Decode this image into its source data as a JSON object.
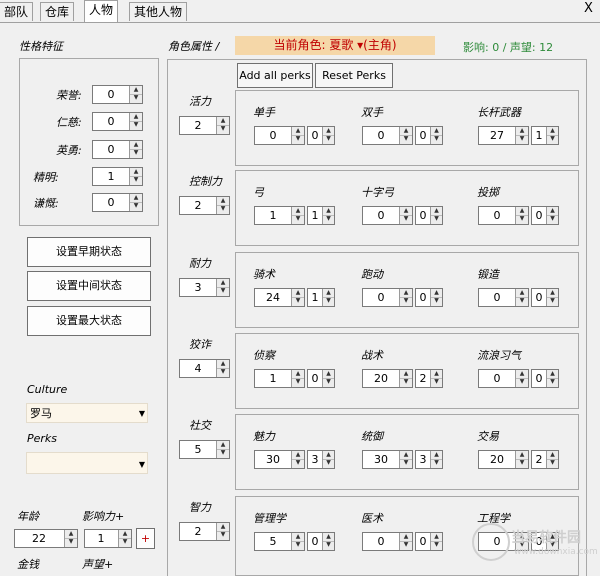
{
  "tabs": [
    "部队",
    "仓库",
    "人物",
    "其他人物"
  ],
  "close_label": "X",
  "personality": {
    "title": "性格特征",
    "traits": [
      {
        "label": "荣誉:",
        "value": "0"
      },
      {
        "label": "仁慈:",
        "value": "0"
      },
      {
        "label": "英勇:",
        "value": "0"
      },
      {
        "label": "精明:",
        "value": "1"
      },
      {
        "label": "谦慨:",
        "value": "0"
      }
    ]
  },
  "state_buttons": [
    "设置早期状态",
    "设置中间状态",
    "设置最大状态"
  ],
  "culture": {
    "label": "Culture",
    "value": "罗马"
  },
  "perks": {
    "label": "Perks",
    "value": ""
  },
  "age": {
    "label": "年龄",
    "value": "22"
  },
  "influence_plus": {
    "label": "影响力+",
    "value": "1",
    "button": "+"
  },
  "gold": {
    "label": "金钱"
  },
  "renown_plus": {
    "label": "声望+"
  },
  "attributes_title": "角色属性",
  "attributes_title_suffix": "/",
  "current_role": "当前角色: 夏歌 ▾(主角)",
  "influence_renown": "影响: 0 / 声望: 12",
  "add_all_perks": "Add all perks",
  "reset_perks": "Reset Perks",
  "attributes": [
    {
      "name": "活力",
      "value": "2",
      "skills": [
        {
          "name": "单手",
          "value": "0",
          "focus": "0"
        },
        {
          "name": "双手",
          "value": "0",
          "focus": "0"
        },
        {
          "name": "长杆武器",
          "value": "27",
          "focus": "1"
        }
      ]
    },
    {
      "name": "控制力",
      "value": "2",
      "skills": [
        {
          "name": "弓",
          "value": "1",
          "focus": "1"
        },
        {
          "name": "十字弓",
          "value": "0",
          "focus": "0"
        },
        {
          "name": "投掷",
          "value": "0",
          "focus": "0"
        }
      ]
    },
    {
      "name": "耐力",
      "value": "3",
      "skills": [
        {
          "name": "骑术",
          "value": "24",
          "focus": "1"
        },
        {
          "name": "跑动",
          "value": "0",
          "focus": "0"
        },
        {
          "name": "锻造",
          "value": "0",
          "focus": "0"
        }
      ]
    },
    {
      "name": "狡诈",
      "value": "4",
      "skills": [
        {
          "name": "侦察",
          "value": "1",
          "focus": "0"
        },
        {
          "name": "战术",
          "value": "20",
          "focus": "2"
        },
        {
          "name": "流浪习气",
          "value": "0",
          "focus": "0"
        }
      ]
    },
    {
      "name": "社交",
      "value": "5",
      "skills": [
        {
          "name": "魅力",
          "value": "30",
          "focus": "3"
        },
        {
          "name": "统御",
          "value": "30",
          "focus": "3"
        },
        {
          "name": "交易",
          "value": "20",
          "focus": "2"
        }
      ]
    },
    {
      "name": "智力",
      "value": "2",
      "skills": [
        {
          "name": "管理学",
          "value": "5",
          "focus": "0"
        },
        {
          "name": "医术",
          "value": "0",
          "focus": "0"
        },
        {
          "name": "工程学",
          "value": "0",
          "focus": "0"
        }
      ]
    }
  ],
  "watermark": "当易软件园",
  "watermark_url": "www.downxia.com",
  "colors": {
    "role_bg": "#f5d7a8",
    "role_text": "#c00000",
    "influence_text": "#2e8b3a",
    "plus_text": "#c00000"
  }
}
